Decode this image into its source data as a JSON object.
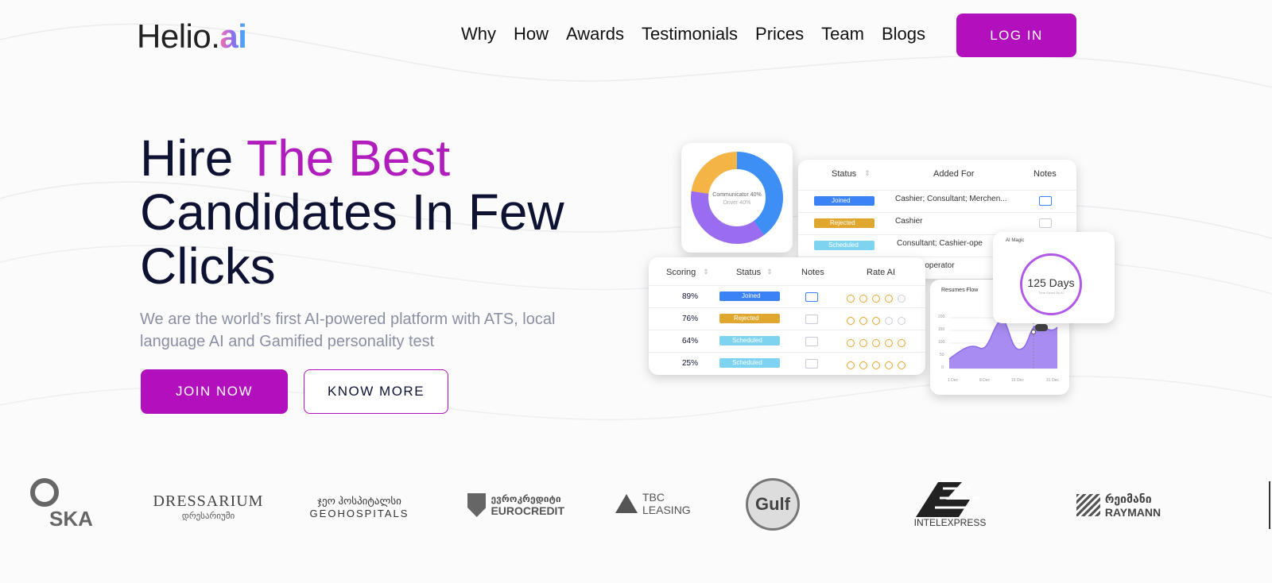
{
  "logo": {
    "text": "Helio.",
    "accent": "ai"
  },
  "nav": {
    "items": [
      "Why",
      "How",
      "Awards",
      "Testimonials",
      "Prices",
      "Team",
      "Blogs"
    ],
    "login_label": "LOG IN"
  },
  "hero": {
    "title_part1": "Hire ",
    "title_accent": "The Best",
    "title_line2": "Candidates In Few",
    "title_line3": "Clicks",
    "subtitle": "We are  the world’s first AI-powered platform with ATS, local language AI and Gamified personality test",
    "join_label": "JOIN NOW",
    "know_label": "KNOW MORE"
  },
  "mockup": {
    "donut": {
      "label1": "Communicator 40%",
      "label2": "Driver 40%"
    },
    "top_table": {
      "headers": [
        "Status",
        "Added For",
        "Notes"
      ],
      "rows": [
        {
          "status": "Joined",
          "added_for": "Cashier; Consultant; Merchen..."
        },
        {
          "status": "Rejected",
          "added_for": "Cashier"
        },
        {
          "status": "Scheduled",
          "added_for": "Consultant; Cashier-ope"
        },
        {
          "added_for": "-operator"
        }
      ]
    },
    "front_table": {
      "headers": [
        "Scoring",
        "Status",
        "Notes",
        "Rate AI"
      ],
      "rows": [
        {
          "score": "89%",
          "status": "Joined",
          "rating": 4
        },
        {
          "score": "76%",
          "status": "Rejected",
          "rating": 3
        },
        {
          "score": "64%",
          "status": "Scheduled",
          "rating": 5
        },
        {
          "score": "25%",
          "status": "Scheduled",
          "rating": 5
        }
      ]
    },
    "ai_magic": {
      "title": "AI Magic",
      "value": "125 Days",
      "caption": "Time Saved By AI"
    },
    "resumes": {
      "title": "Resumes Flow",
      "x_labels": [
        "1 Dec",
        "8 Dec",
        "16 Dec",
        "31 Dec"
      ],
      "y_labels": [
        "200",
        "150",
        "100",
        "50",
        "0"
      ]
    }
  },
  "partners": {
    "oska": "SKA",
    "dressarium": "DRESSARIUM",
    "dressarium_sub": "დრესარიუმი",
    "geo_ka": "ჯეო ჰოსპიტალსი",
    "geo": "GEOHOSPITALS",
    "euro_ka": "ევროკრედიტი",
    "euro": "EUROCREDIT",
    "tbc": "TBC LEASING",
    "gulf": "Gulf",
    "intel": "INTELEXPRESS",
    "raymann_ka": "რეიმანი",
    "raymann": "RAYMANN"
  }
}
